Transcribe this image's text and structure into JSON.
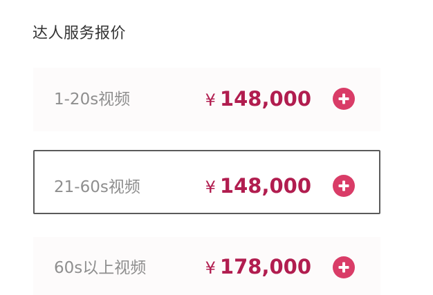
{
  "section": {
    "title": "达人服务报价"
  },
  "rows": [
    {
      "label": "1-20s视频",
      "currency": "¥",
      "price": "148,000",
      "add_icon": "plus-circle-icon"
    },
    {
      "label": "21-60s视频",
      "currency": "¥",
      "price": "148,000",
      "add_icon": "plus-circle-icon",
      "selected": true
    },
    {
      "label": "60s以上视频",
      "currency": "¥",
      "price": "178,000",
      "add_icon": "plus-circle-icon"
    }
  ],
  "colors": {
    "price": "#b11d4f",
    "add_button": "#d93c67",
    "label": "#8e8e8e",
    "title": "#333333",
    "selected_border": "#5a5a5a"
  }
}
